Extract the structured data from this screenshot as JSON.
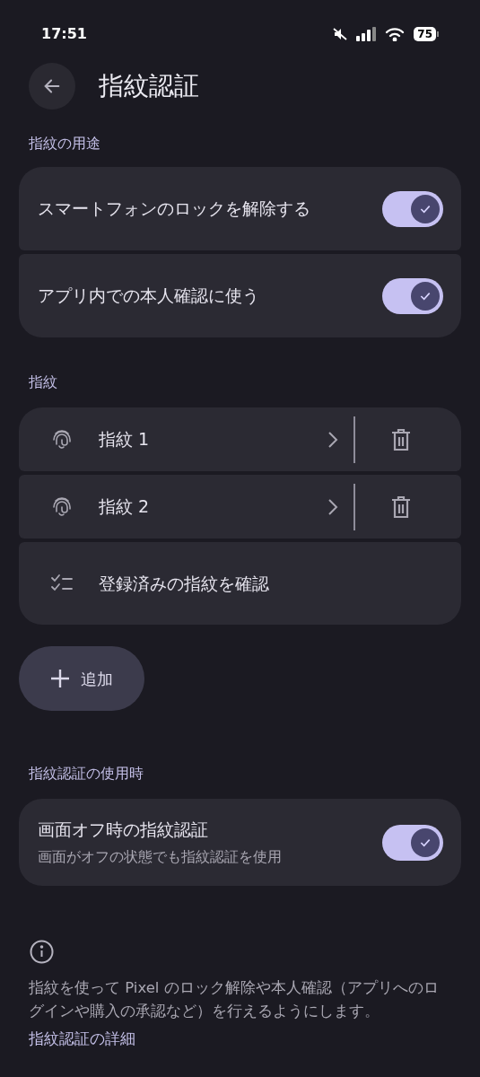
{
  "status_bar": {
    "time": "17:51",
    "battery": "75"
  },
  "header": {
    "title": "指紋認証"
  },
  "usage": {
    "label": "指紋の用途",
    "items": [
      {
        "title": "スマートフォンのロックを解除する",
        "on": true
      },
      {
        "title": "アプリ内での本人確認に使う",
        "on": true
      }
    ]
  },
  "fingerprints": {
    "label": "指紋",
    "items": [
      {
        "kind": "fingerprint",
        "title": "指紋 1"
      },
      {
        "kind": "fingerprint",
        "title": "指紋 2"
      },
      {
        "kind": "check",
        "title": "登録済みの指紋を確認"
      }
    ]
  },
  "add_button": {
    "label": "追加"
  },
  "when": {
    "label": "指紋認証の使用時",
    "items": [
      {
        "title": "画面オフ時の指紋認証",
        "subtitle": "画面がオフの状態でも指紋認証を使用",
        "on": true
      }
    ]
  },
  "info": {
    "text": "指紋を使って Pixel のロック解除や本人確認（アプリへのログインや購入の承認など）を行えるようにします。",
    "link": "指紋認証の詳細"
  }
}
